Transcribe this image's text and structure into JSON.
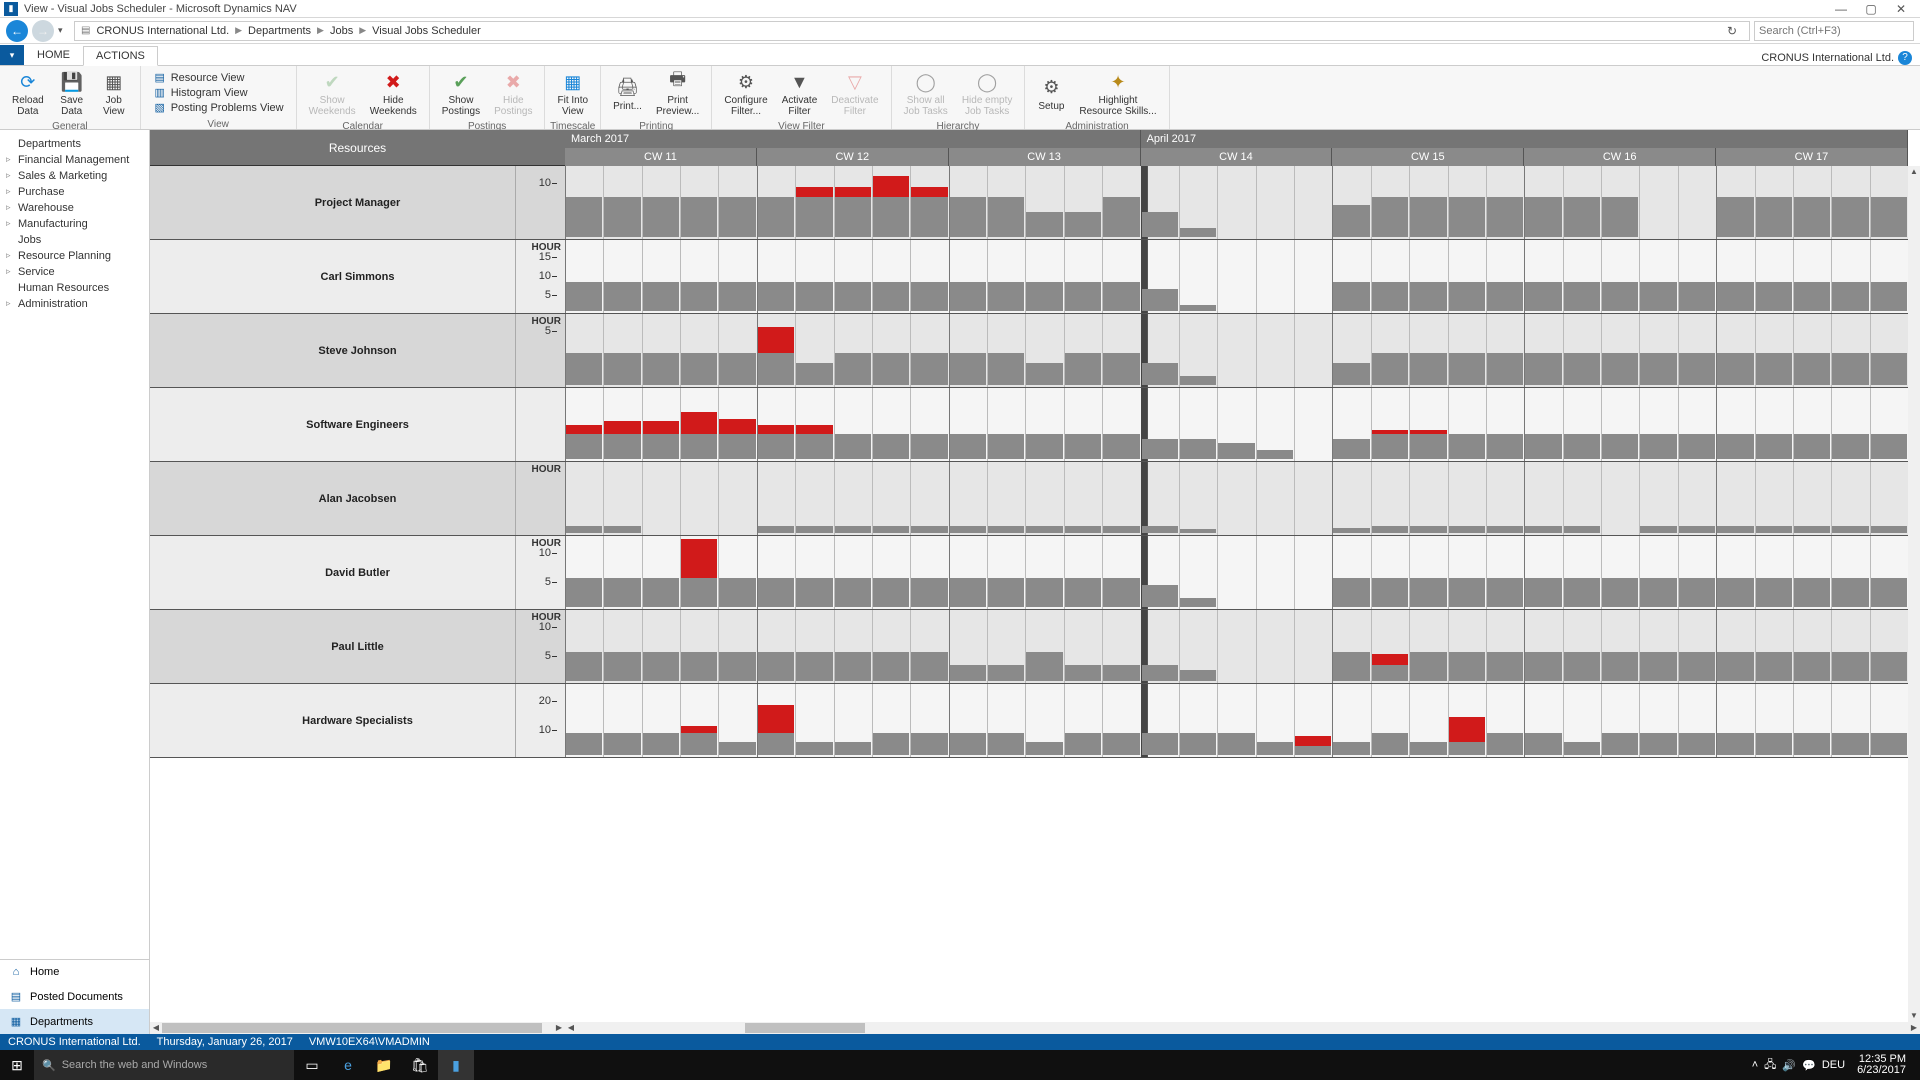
{
  "window": {
    "title": "View - Visual Jobs Scheduler - Microsoft Dynamics NAV"
  },
  "breadcrumb": {
    "root": "CRONUS International Ltd.",
    "items": [
      "Departments",
      "Jobs",
      "Visual Jobs Scheduler"
    ]
  },
  "search": {
    "placeholder": "Search (Ctrl+F3)"
  },
  "tabs": {
    "home": "HOME",
    "actions": "ACTIONS"
  },
  "company": "CRONUS International Ltd.",
  "ribbon": {
    "general": {
      "label": "General",
      "reload": "Reload\nData",
      "save": "Save\nData",
      "job": "Job\nView"
    },
    "view": {
      "label": "View",
      "resource": "Resource View",
      "histogram": "Histogram View",
      "posting": "Posting Problems View"
    },
    "calendar": {
      "label": "Calendar",
      "showW": "Show\nWeekends",
      "hideW": "Hide\nWeekends"
    },
    "postings": {
      "label": "Postings",
      "showP": "Show\nPostings",
      "hideP": "Hide\nPostings"
    },
    "timescale": {
      "label": "Timescale",
      "fit": "Fit Into\nView"
    },
    "printing": {
      "label": "Printing",
      "print": "Print...",
      "preview": "Print\nPreview..."
    },
    "viewfilter": {
      "label": "View Filter",
      "configure": "Configure\nFilter...",
      "activate": "Activate\nFilter",
      "deactivate": "Deactivate\nFilter"
    },
    "hierarchy": {
      "label": "Hierarchy",
      "showAll": "Show all\nJob Tasks",
      "hideEmpty": "Hide empty\nJob Tasks"
    },
    "admin": {
      "label": "Administration",
      "setup": "Setup",
      "highlight": "Highlight\nResource Skills..."
    }
  },
  "navtree": {
    "items": [
      {
        "label": "Departments",
        "has": false
      },
      {
        "label": "Financial Management",
        "has": true
      },
      {
        "label": "Sales & Marketing",
        "has": true
      },
      {
        "label": "Purchase",
        "has": true
      },
      {
        "label": "Warehouse",
        "has": true
      },
      {
        "label": "Manufacturing",
        "has": true
      },
      {
        "label": "Jobs",
        "has": false
      },
      {
        "label": "Resource Planning",
        "has": true
      },
      {
        "label": "Service",
        "has": true
      },
      {
        "label": "Human Resources",
        "has": false
      },
      {
        "label": "Administration",
        "has": true
      }
    ]
  },
  "bottomnav": {
    "home": "Home",
    "posted": "Posted Documents",
    "dept": "Departments"
  },
  "scheduler": {
    "resources_header": "Resources",
    "months": [
      {
        "label": "March 2017",
        "weeks": 3
      },
      {
        "label": "April 2017",
        "weeks": 4
      }
    ],
    "weeks": [
      "CW 11",
      "CW 12",
      "CW 13",
      "CW 14",
      "CW 15",
      "CW 16",
      "CW 17"
    ],
    "rows": [
      {
        "name": "Project Manager",
        "axis_unit": "",
        "ticks": [
          {
            "v": 10,
            "label": "10"
          }
        ]
      },
      {
        "name": "Carl Simmons",
        "axis_unit": "HOUR",
        "ticks": [
          {
            "v": 5,
            "label": "5"
          },
          {
            "v": 10,
            "label": "10"
          },
          {
            "v": 15,
            "label": "15"
          }
        ]
      },
      {
        "name": "Steve Johnson",
        "axis_unit": "HOUR",
        "ticks": [
          {
            "v": 5,
            "label": "5"
          }
        ]
      },
      {
        "name": "Software Engineers",
        "axis_unit": "",
        "ticks": []
      },
      {
        "name": "Alan Jacobsen",
        "axis_unit": "HOUR",
        "ticks": []
      },
      {
        "name": "David Butler",
        "axis_unit": "HOUR",
        "ticks": [
          {
            "v": 5,
            "label": "5"
          },
          {
            "v": 10,
            "label": "10"
          }
        ]
      },
      {
        "name": "Paul Little",
        "axis_unit": "HOUR",
        "ticks": [
          {
            "v": 5,
            "label": "5"
          },
          {
            "v": 10,
            "label": "10"
          }
        ]
      },
      {
        "name": "Hardware Specialists",
        "axis_unit": "",
        "ticks": [
          {
            "v": 10,
            "label": "10"
          },
          {
            "v": 20,
            "label": "20"
          }
        ]
      }
    ]
  },
  "chart_data": {
    "type": "bar",
    "note": "Resource load histogram per day across calendar weeks. Grey = within capacity, Red = overload. Values are relative heights (0-1 of row height).",
    "weeks": [
      "CW 11",
      "CW 12",
      "CW 13",
      "CW 14",
      "CW 15",
      "CW 16",
      "CW 17"
    ],
    "days_per_week": 5,
    "series": [
      {
        "resource": "Project Manager",
        "grey": [
          [
            0.55,
            0.55,
            0.55,
            0.55,
            0.55
          ],
          [
            0.55,
            0.55,
            0.55,
            0.55,
            0.55
          ],
          [
            0.55,
            0.55,
            0.35,
            0.35,
            0.55
          ],
          [
            0.35,
            0.12,
            0,
            0,
            0
          ],
          [
            0.45,
            0.55,
            0.55,
            0.55,
            0.55
          ],
          [
            0.55,
            0.55,
            0.55,
            0,
            0
          ],
          [
            0.55,
            0.55,
            0.55,
            0.55,
            0.55
          ]
        ],
        "red": [
          [
            0,
            0,
            0,
            0,
            0
          ],
          [
            0,
            0.15,
            0.15,
            0.3,
            0.15
          ],
          [
            0,
            0,
            0,
            0,
            0
          ],
          [
            0,
            0,
            0,
            0,
            0
          ],
          [
            0,
            0,
            0,
            0,
            0
          ],
          [
            0,
            0,
            0,
            0,
            0
          ],
          [
            0,
            0,
            0,
            0,
            0
          ]
        ]
      },
      {
        "resource": "Carl Simmons",
        "grey": [
          [
            0.4,
            0.4,
            0.4,
            0.4,
            0.4
          ],
          [
            0.4,
            0.4,
            0.4,
            0.4,
            0.4
          ],
          [
            0.4,
            0.4,
            0.4,
            0.4,
            0.4
          ],
          [
            0.3,
            0.08,
            0,
            0,
            0
          ],
          [
            0.4,
            0.4,
            0.4,
            0.4,
            0.4
          ],
          [
            0.4,
            0.4,
            0.4,
            0.4,
            0.4
          ],
          [
            0.4,
            0.4,
            0.4,
            0.4,
            0.4
          ]
        ],
        "red": [
          [
            0,
            0,
            0,
            0,
            0
          ],
          [
            0,
            0,
            0,
            0,
            0
          ],
          [
            0,
            0,
            0,
            0,
            0
          ],
          [
            0,
            0,
            0,
            0,
            0
          ],
          [
            0,
            0,
            0,
            0,
            0
          ],
          [
            0,
            0,
            0,
            0,
            0
          ],
          [
            0,
            0,
            0,
            0,
            0
          ]
        ]
      },
      {
        "resource": "Steve Johnson",
        "grey": [
          [
            0.45,
            0.45,
            0.45,
            0.45,
            0.45
          ],
          [
            0.45,
            0.3,
            0.45,
            0.45,
            0.45
          ],
          [
            0.45,
            0.45,
            0.3,
            0.45,
            0.45
          ],
          [
            0.3,
            0.12,
            0,
            0,
            0
          ],
          [
            0.3,
            0.45,
            0.45,
            0.45,
            0.45
          ],
          [
            0.45,
            0.45,
            0.45,
            0.45,
            0.45
          ],
          [
            0.45,
            0.45,
            0.45,
            0.45,
            0.45
          ]
        ],
        "red": [
          [
            0,
            0,
            0,
            0,
            0
          ],
          [
            0.35,
            0,
            0,
            0,
            0
          ],
          [
            0,
            0,
            0,
            0,
            0
          ],
          [
            0,
            0,
            0,
            0,
            0
          ],
          [
            0,
            0,
            0,
            0,
            0
          ],
          [
            0,
            0,
            0,
            0,
            0
          ],
          [
            0,
            0,
            0,
            0,
            0
          ]
        ]
      },
      {
        "resource": "Software Engineers",
        "grey": [
          [
            0.35,
            0.35,
            0.35,
            0.35,
            0.35
          ],
          [
            0.35,
            0.35,
            0.35,
            0.35,
            0.35
          ],
          [
            0.35,
            0.35,
            0.35,
            0.35,
            0.35
          ],
          [
            0.28,
            0.28,
            0.22,
            0.12,
            0
          ],
          [
            0.28,
            0.35,
            0.35,
            0.35,
            0.35
          ],
          [
            0.35,
            0.35,
            0.35,
            0.35,
            0.35
          ],
          [
            0.35,
            0.35,
            0.35,
            0.35,
            0.35
          ]
        ],
        "red": [
          [
            0.12,
            0.18,
            0.18,
            0.3,
            0.2
          ],
          [
            0.12,
            0.12,
            0,
            0,
            0
          ],
          [
            0,
            0,
            0,
            0,
            0
          ],
          [
            0,
            0,
            0,
            0,
            0
          ],
          [
            0,
            0.05,
            0.05,
            0,
            0
          ],
          [
            0,
            0,
            0,
            0,
            0
          ],
          [
            0,
            0,
            0,
            0,
            0
          ]
        ]
      },
      {
        "resource": "Alan Jacobsen",
        "grey": [
          [
            0.1,
            0.1,
            0,
            0,
            0
          ],
          [
            0.1,
            0.1,
            0.1,
            0.1,
            0.1
          ],
          [
            0.1,
            0.1,
            0.1,
            0.1,
            0.1
          ],
          [
            0.1,
            0.05,
            0,
            0,
            0
          ],
          [
            0.07,
            0.1,
            0.1,
            0.1,
            0.1
          ],
          [
            0.1,
            0.1,
            0,
            0.1,
            0.1
          ],
          [
            0.1,
            0.1,
            0.1,
            0.1,
            0.1
          ]
        ],
        "red": [
          [
            0,
            0,
            0,
            0,
            0
          ],
          [
            0,
            0,
            0,
            0,
            0
          ],
          [
            0,
            0,
            0,
            0,
            0
          ],
          [
            0,
            0,
            0,
            0,
            0
          ],
          [
            0,
            0,
            0,
            0,
            0
          ],
          [
            0,
            0,
            0,
            0,
            0
          ],
          [
            0,
            0,
            0,
            0,
            0
          ]
        ]
      },
      {
        "resource": "David Butler",
        "grey": [
          [
            0.4,
            0.4,
            0.4,
            0.4,
            0.4
          ],
          [
            0.4,
            0.4,
            0.4,
            0.4,
            0.4
          ],
          [
            0.4,
            0.4,
            0.4,
            0.4,
            0.4
          ],
          [
            0.3,
            0.12,
            0,
            0,
            0
          ],
          [
            0.4,
            0.4,
            0.4,
            0.4,
            0.4
          ],
          [
            0.4,
            0.4,
            0.4,
            0.4,
            0.4
          ],
          [
            0.4,
            0.4,
            0.4,
            0.4,
            0.4
          ]
        ],
        "red": [
          [
            0,
            0,
            0,
            0.55,
            0
          ],
          [
            0,
            0,
            0,
            0,
            0
          ],
          [
            0,
            0,
            0,
            0,
            0
          ],
          [
            0,
            0,
            0,
            0,
            0
          ],
          [
            0,
            0,
            0,
            0,
            0
          ],
          [
            0,
            0,
            0,
            0,
            0
          ],
          [
            0,
            0,
            0,
            0,
            0
          ]
        ]
      },
      {
        "resource": "Paul Little",
        "grey": [
          [
            0.4,
            0.4,
            0.4,
            0.4,
            0.4
          ],
          [
            0.4,
            0.4,
            0.4,
            0.4,
            0.4
          ],
          [
            0.22,
            0.22,
            0.4,
            0.22,
            0.22
          ],
          [
            0.22,
            0.15,
            0,
            0,
            0
          ],
          [
            0.4,
            0.22,
            0.4,
            0.4,
            0.4
          ],
          [
            0.4,
            0.4,
            0.4,
            0.4,
            0.4
          ],
          [
            0.4,
            0.4,
            0.4,
            0.4,
            0.4
          ]
        ],
        "red": [
          [
            0,
            0,
            0,
            0,
            0
          ],
          [
            0,
            0,
            0,
            0,
            0
          ],
          [
            0,
            0,
            0,
            0,
            0
          ],
          [
            0,
            0,
            0,
            0,
            0
          ],
          [
            0,
            0.15,
            0,
            0,
            0
          ],
          [
            0,
            0,
            0,
            0,
            0
          ],
          [
            0,
            0,
            0,
            0,
            0
          ]
        ]
      },
      {
        "resource": "Hardware Specialists",
        "grey": [
          [
            0.3,
            0.3,
            0.3,
            0.3,
            0.18
          ],
          [
            0.3,
            0.18,
            0.18,
            0.3,
            0.3
          ],
          [
            0.3,
            0.3,
            0.18,
            0.3,
            0.3
          ],
          [
            0.3,
            0.3,
            0.3,
            0.18,
            0.12
          ],
          [
            0.18,
            0.3,
            0.18,
            0.18,
            0.3
          ],
          [
            0.3,
            0.18,
            0.3,
            0.3,
            0.3
          ],
          [
            0.3,
            0.3,
            0.3,
            0.3,
            0.3
          ]
        ],
        "red": [
          [
            0,
            0,
            0,
            0.1,
            0
          ],
          [
            0.4,
            0,
            0,
            0,
            0
          ],
          [
            0,
            0,
            0,
            0,
            0
          ],
          [
            0,
            0,
            0,
            0,
            0.15
          ],
          [
            0,
            0,
            0,
            0.35,
            0
          ],
          [
            0,
            0,
            0,
            0,
            0
          ],
          [
            0,
            0,
            0,
            0,
            0
          ]
        ]
      }
    ]
  },
  "bluebar": {
    "company": "CRONUS International Ltd.",
    "date": "Thursday, January 26, 2017",
    "user": "VMW10EX64\\VMADMIN"
  },
  "taskbar": {
    "search": "Search the web and Windows",
    "lang": "DEU",
    "time": "12:35 PM",
    "date": "6/23/2017"
  }
}
